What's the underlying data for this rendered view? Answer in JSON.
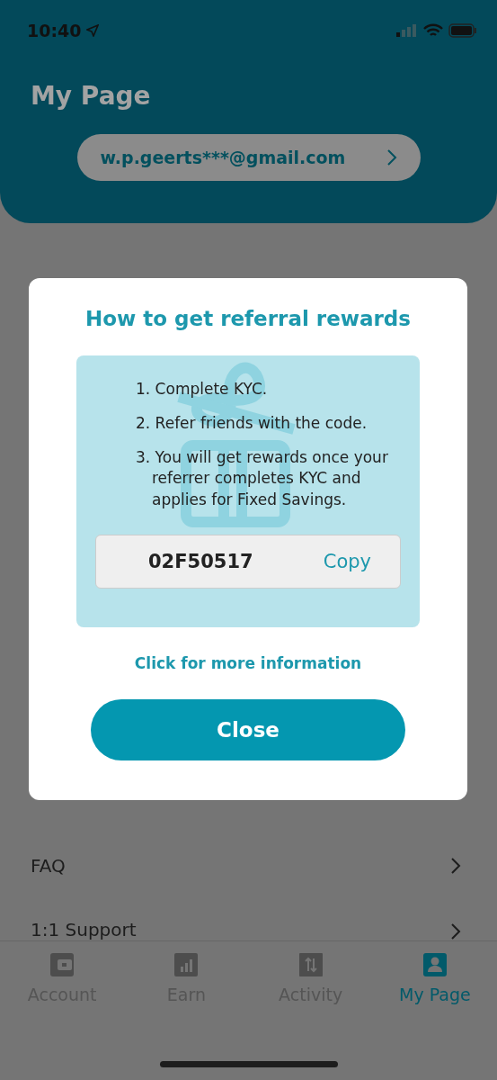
{
  "status_bar": {
    "time": "10:40"
  },
  "header": {
    "title": "My Page",
    "account_email": "w.p.geerts***@gmail.com"
  },
  "menu": [
    {
      "label": "FAQ"
    },
    {
      "label": "1:1 Support"
    }
  ],
  "nav": [
    {
      "label": "Account",
      "kind": "wallet",
      "selected": false
    },
    {
      "label": "Earn",
      "kind": "chart",
      "selected": false
    },
    {
      "label": "Activity",
      "kind": "transfer",
      "selected": false
    },
    {
      "label": "My Page",
      "kind": "person",
      "selected": true
    }
  ],
  "modal": {
    "title": "How to get referral rewards",
    "steps": [
      "1. Complete KYC.",
      "2. Refer friends with the code.",
      "3. You will get rewards once your referrer completes KYC and applies for Fixed Savings."
    ],
    "code": "02F50517",
    "copy_label": "Copy",
    "link": "Click for more information",
    "close_label": "Close"
  }
}
